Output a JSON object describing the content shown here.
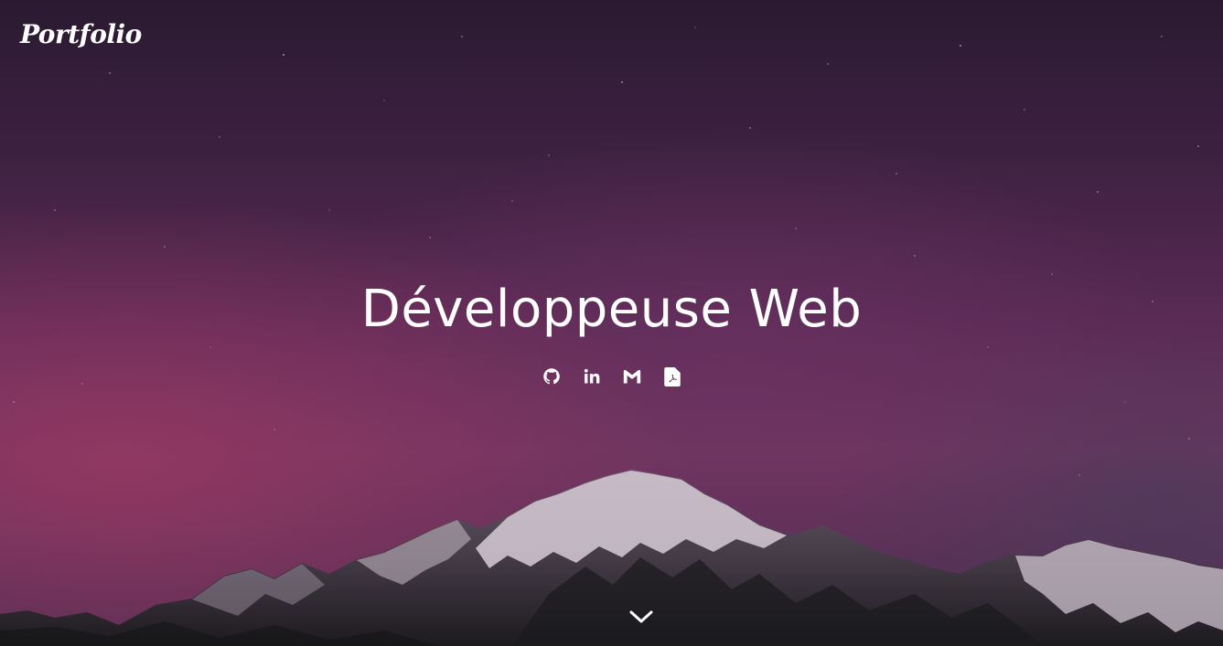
{
  "header": {
    "logo_text": "Portfolio"
  },
  "hero": {
    "title": "Développeuse Web",
    "social_links": [
      {
        "name": "github",
        "icon": "github-icon"
      },
      {
        "name": "linkedin",
        "icon": "linkedin-icon"
      },
      {
        "name": "gmail",
        "icon": "gmail-icon"
      },
      {
        "name": "cv-pdf",
        "icon": "pdf-file-icon"
      }
    ],
    "scroll_icon": "chevron-down-icon"
  },
  "colors": {
    "text": "#ffffff",
    "sky_top": "#2a1a30",
    "sky_glow": "#963862",
    "mountain_shadow": "#1e1e20",
    "snow": "#d9cdd8"
  }
}
